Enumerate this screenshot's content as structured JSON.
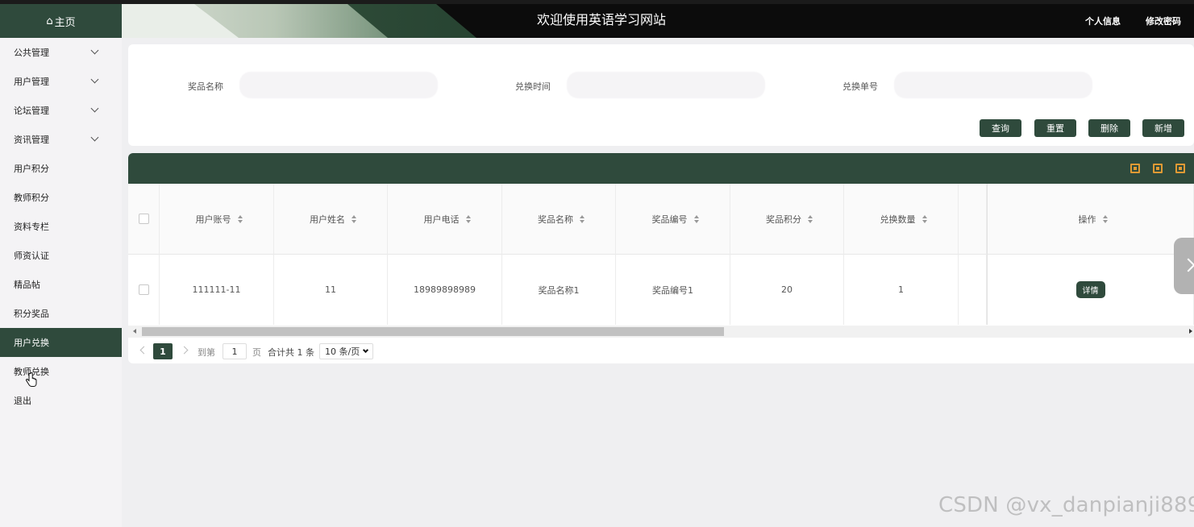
{
  "header": {
    "title": "欢迎使用英语学习网站",
    "profile_link": "个人信息",
    "password_link": "修改密码"
  },
  "sidebar": {
    "home": "主页",
    "items": [
      {
        "label": "公共管理",
        "expandable": true
      },
      {
        "label": "用户管理",
        "expandable": true
      },
      {
        "label": "论坛管理",
        "expandable": true
      },
      {
        "label": "资讯管理",
        "expandable": true
      },
      {
        "label": "用户积分",
        "expandable": false
      },
      {
        "label": "教师积分",
        "expandable": false
      },
      {
        "label": "资料专栏",
        "expandable": false
      },
      {
        "label": "师资认证",
        "expandable": false
      },
      {
        "label": "精品帖",
        "expandable": false
      },
      {
        "label": "积分奖品",
        "expandable": false
      },
      {
        "label": "用户兑换",
        "expandable": false,
        "active": true
      },
      {
        "label": "教师兑换",
        "expandable": false
      },
      {
        "label": "退出",
        "expandable": false
      }
    ]
  },
  "search": {
    "fields": [
      {
        "label": "奖品名称",
        "value": ""
      },
      {
        "label": "兑换时间",
        "value": ""
      },
      {
        "label": "兑换单号",
        "value": ""
      }
    ],
    "buttons": {
      "query": "查询",
      "reset": "重置",
      "delete": "删除",
      "add": "新增"
    }
  },
  "table": {
    "columns": [
      "用户账号",
      "用户姓名",
      "用户电话",
      "奖品名称",
      "奖品编号",
      "奖品积分",
      "兑换数量",
      "操作"
    ],
    "rows": [
      {
        "account": "111111-11",
        "name": "11",
        "phone": "18989898989",
        "prize_name": "奖品名称1",
        "prize_no": "奖品编号1",
        "points": "20",
        "quantity": "1",
        "action": "详情"
      }
    ],
    "toolbar_icons": [
      "grid-icon",
      "export-icon",
      "print-icon"
    ]
  },
  "pagination": {
    "current_page": "1",
    "goto_prefix": "到第",
    "goto_value": "1",
    "goto_suffix": "页",
    "total": "合计共 1 条",
    "page_size": "10 条/页"
  },
  "watermark": "CSDN @vx_danpianji889",
  "colors": {
    "primary": "#2f4a3c",
    "accent": "#e09a34"
  }
}
